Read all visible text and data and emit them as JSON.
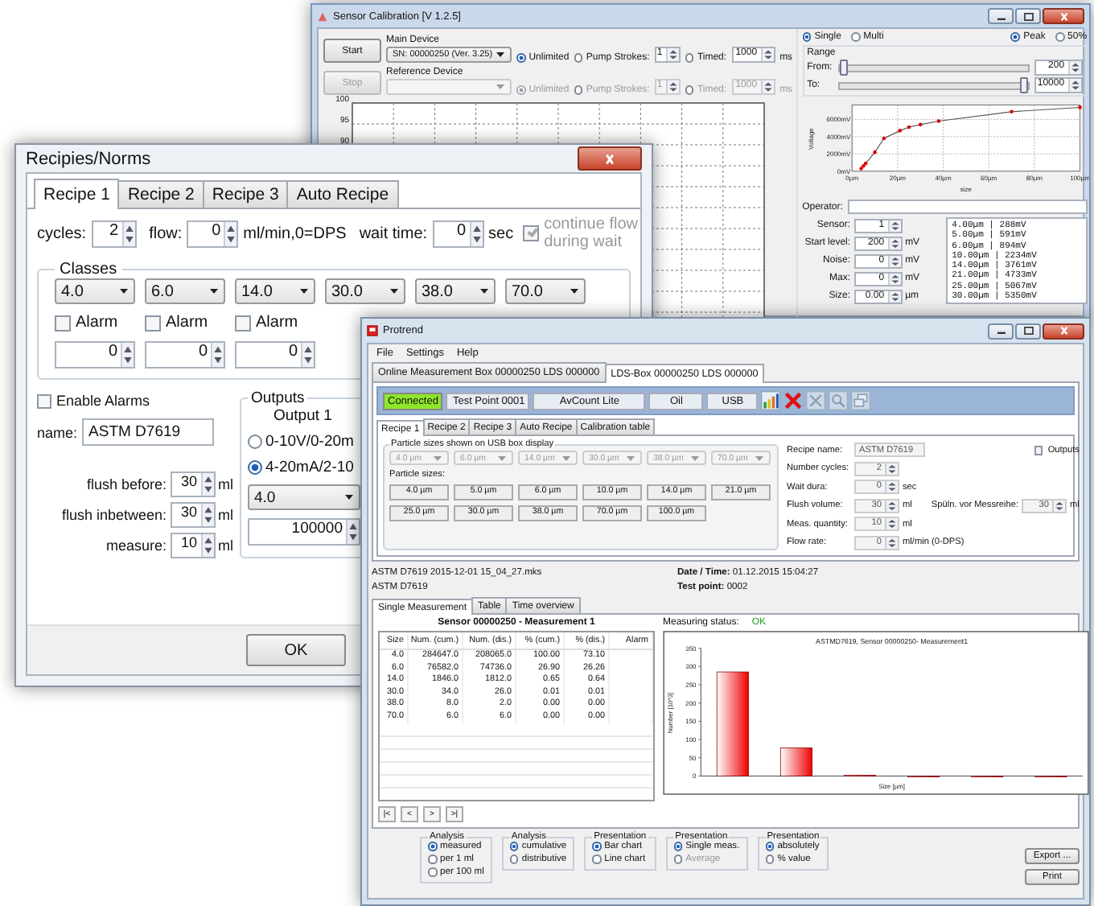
{
  "calibration_window": {
    "title": "Sensor Calibration [V 1.2.5]",
    "devices": [
      {
        "button": "Start",
        "label": "Main Device",
        "value": "SN: 00000250 (Ver. 3.25)",
        "disabled": false,
        "modes": [
          {
            "label": "Unlimited",
            "selected": true
          },
          {
            "label": "Pump Strokes:",
            "selected": false
          },
          {
            "label": "Timed:",
            "selected": false
          }
        ],
        "strokes": "1",
        "time": "1000",
        "unit": "ms"
      },
      {
        "button": "Stop",
        "label": "Reference Device",
        "disabled": true,
        "modes": [
          {
            "label": "Unlimited",
            "selected": true
          },
          {
            "label": "Pump Strokes:",
            "selected": false
          },
          {
            "label": "Timed:",
            "selected": false
          }
        ],
        "strokes": "1",
        "time": "1000",
        "unit": "ms"
      }
    ],
    "plot": {
      "yticks": [
        "100",
        "95",
        "90"
      ]
    },
    "mode_options": [
      {
        "label": "Single",
        "selected": true
      },
      {
        "label": "Multi",
        "selected": false
      }
    ],
    "peak_options": [
      {
        "label": "Peak",
        "selected": true
      },
      {
        "label": "50%",
        "selected": false
      }
    ],
    "range": {
      "title": "Range",
      "from": {
        "label": "From:",
        "level": 0.0,
        "value": "200"
      },
      "to": {
        "label": "To:",
        "level": 1.0,
        "value": "10000"
      }
    },
    "calibration_chart": {
      "chart_data": {
        "type": "line",
        "xlabel": "size",
        "ylabel": "Voltage",
        "x": [
          4,
          5,
          6,
          10,
          14,
          21,
          25,
          30,
          38,
          70,
          100
        ],
        "values": [
          300,
          600,
          900,
          2200,
          3800,
          4700,
          5100,
          5400,
          5800,
          6900,
          7400
        ],
        "xlim": [
          0,
          100
        ],
        "ylim": [
          0,
          7500
        ],
        "grid": true,
        "xticks": [
          {
            "value": 0,
            "label": "0µm"
          },
          {
            "value": 20,
            "label": "20µm"
          },
          {
            "value": 40,
            "label": "40µm"
          },
          {
            "value": 60,
            "label": "60µm"
          },
          {
            "value": 80,
            "label": "80µm"
          },
          {
            "value": 100,
            "label": "100µm"
          }
        ],
        "yticks": [
          {
            "value": 0,
            "label": "0mV"
          },
          {
            "value": 2000,
            "label": "2000mV"
          },
          {
            "value": 4000,
            "label": "4000mV"
          },
          {
            "value": 6000,
            "label": "6000mV"
          }
        ]
      }
    },
    "operator": {
      "label": "Operator:"
    },
    "fields": [
      {
        "label": "Sensor:",
        "value": "1"
      },
      {
        "label": "Start level:",
        "value": "200",
        "unit": "mV"
      },
      {
        "label": "Noise:",
        "value": "0",
        "unit": "mV"
      },
      {
        "label": "Max:",
        "value": "0",
        "unit": "mV"
      },
      {
        "label": "Size:",
        "value": "0.00",
        "unit": "µm"
      }
    ],
    "points": [
      "4.00µm | 288mV",
      "5.00µm | 591mV",
      "6.00µm | 894mV",
      "10.00µm | 2234mV",
      "14.00µm | 3761mV",
      "21.00µm | 4733mV",
      "25.00µm | 5067mV",
      "30.00µm | 5350mV"
    ]
  },
  "recipes_window": {
    "title": "Recipies/Norms",
    "tabs": [
      {
        "label": "Recipe 1",
        "selected": true
      },
      {
        "label": "Recipe 2",
        "selected": false
      },
      {
        "label": "Recipe 3",
        "selected": false
      },
      {
        "label": "Auto Recipe",
        "selected": false
      }
    ],
    "cycles": {
      "label": "cycles:",
      "value": "2"
    },
    "flow": {
      "label": "flow:",
      "value": "0",
      "unit": "ml/min,0=DPS"
    },
    "wait": {
      "label": "wait time:",
      "value": "0",
      "unit": "sec"
    },
    "continue_flow": {
      "label": "continue flow during wait",
      "checked": true,
      "disabled": true
    },
    "classes": {
      "title": "Classes",
      "sizes": [
        "4.0",
        "6.0",
        "14.0",
        "30.0",
        "38.0",
        "70.0"
      ],
      "alarms": [
        {
          "label": "Alarm",
          "checked": false,
          "value": "0"
        },
        {
          "label": "Alarm",
          "checked": false,
          "value": "0"
        },
        {
          "label": "Alarm",
          "checked": false,
          "value": "0"
        }
      ]
    },
    "enable_alarms": {
      "label": "Enable Alarms",
      "checked": false
    },
    "name": {
      "label": "name:",
      "value": "ASTM D7619"
    },
    "volumes": [
      {
        "label": "flush before:",
        "value": "30",
        "unit": "ml"
      },
      {
        "label": "flush inbetween:",
        "value": "30",
        "unit": "ml"
      },
      {
        "label": "measure:",
        "value": "10",
        "unit": "ml"
      }
    ],
    "outputs": {
      "title": "Outputs",
      "output": "Output 1",
      "options": [
        {
          "label": "0-10V/0-20m",
          "selected": false
        },
        {
          "label": "4-20mA/2-10",
          "selected": true
        }
      ],
      "size": "4.0",
      "value": "100000"
    },
    "buttons": [
      "OK"
    ]
  },
  "protrend_window": {
    "title": "Protrend",
    "menu": [
      "File",
      "Settings",
      "Help"
    ],
    "device_tabs": [
      {
        "label": "Online Measurement Box 00000250 LDS 000000",
        "selected": false
      },
      {
        "label": "LDS-Box 00000250 LDS 000000",
        "selected": true
      }
    ],
    "status": {
      "connection": "Connected",
      "connected": true,
      "fields": [
        "Test Point 0001",
        "AvCount Lite",
        "Oil",
        "USB"
      ]
    },
    "toolbar": [
      {
        "kind": "chart",
        "disabled": false
      },
      {
        "kind": "delete",
        "disabled": false
      },
      {
        "kind": "tools",
        "disabled": true
      },
      {
        "kind": "search",
        "disabled": true
      },
      {
        "kind": "windows",
        "disabled": true
      }
    ],
    "recipe_tabs": [
      {
        "label": "Recipe 1",
        "selected": true
      },
      {
        "label": "Recipe 2",
        "selected": false
      },
      {
        "label": "Recipe 3",
        "selected": false
      },
      {
        "label": "Auto Recipe",
        "selected": false
      },
      {
        "label": "Calibration table",
        "selected": false
      }
    ],
    "display_sizes": {
      "title": "Particle sizes shown on USB box display",
      "values": [
        "4.0 µm",
        "6.0 µm",
        "14.0 µm",
        "30.0 µm",
        "38.0 µm",
        "70.0 µm"
      ]
    },
    "particle_sizes": {
      "title": "Particle sizes:",
      "values": [
        "4.0 µm",
        "5.0 µm",
        "6.0 µm",
        "10.0 µm",
        "14.0 µm",
        "21.0 µm",
        "25.0 µm",
        "30.0 µm",
        "38.0 µm",
        "70.0 µm",
        "100.0 µm"
      ]
    },
    "recipe_fields": [
      {
        "kind": "text",
        "label": "Recipe name:",
        "value": "ASTM D7619"
      },
      {
        "kind": "spin",
        "label": "Number cycles:",
        "value": "2"
      },
      {
        "kind": "spin",
        "label": "Wait dura:",
        "value": "0",
        "unit": "sec"
      },
      {
        "kind": "spin",
        "label": "Flush volume:",
        "value": "30",
        "unit": "ml",
        "extra": {
          "label": "Spüln. vor Messreihe:",
          "value": "30",
          "unit": "ml"
        }
      },
      {
        "kind": "spin",
        "label": "Meas. quantity:",
        "value": "10",
        "unit": "ml"
      },
      {
        "kind": "spin",
        "label": "Flow rate:",
        "value": "0",
        "unit": "ml/min (0-DPS)"
      }
    ],
    "outputs_check": {
      "label": "Outputs",
      "checked": false
    },
    "file": "ASTM D7619 2015-12-01 15_04_27.mks",
    "recipe": "ASTM D7619",
    "date": {
      "label": "Date / Time:",
      "value": "01.12.2015 15:04:27"
    },
    "test_point": {
      "label": "Test point:",
      "value": "0002"
    },
    "view_tabs": [
      {
        "label": "Single Measurement",
        "selected": true
      },
      {
        "label": "Table",
        "selected": false
      },
      {
        "label": "Time overview",
        "selected": false
      }
    ],
    "table": {
      "title": "Sensor 00000250 - Measurement 1",
      "columns": [
        "Size",
        "Num. (cum.)",
        "Num. (dis.)",
        "% (cum.)",
        "% (dis.)",
        "Alarm"
      ],
      "rows": [
        [
          "4.0",
          "284647.0",
          "208065.0",
          "100.00",
          "73.10"
        ],
        [
          "6.0",
          "76582.0",
          "74736.0",
          "26.90",
          "26.26"
        ],
        [
          "14.0",
          "1846.0",
          "1812.0",
          "0.65",
          "0.64"
        ],
        [
          "30.0",
          "34.0",
          "26.0",
          "0.01",
          "0.01"
        ],
        [
          "38.0",
          "8.0",
          "2.0",
          "0.00",
          "0.00"
        ],
        [
          "70.0",
          "6.0",
          "6.0",
          "0.00",
          "0.00"
        ]
      ]
    },
    "measuring_status": {
      "label": "Measuring status:",
      "value": "OK"
    },
    "chart": {
      "chart_data": {
        "type": "bar",
        "title": "ASTMD7619, Sensor 00000250- Measurement1",
        "xlabel": "Size [µm]",
        "ylabel": "Number [10^3]",
        "values": [
          285,
          77,
          2,
          0,
          0,
          0
        ],
        "ylim": [
          0,
          350
        ],
        "yticks": [
          0,
          50,
          100,
          150,
          200,
          250,
          300,
          350
        ]
      }
    },
    "nav": [
      "|<",
      "<",
      ">",
      ">|"
    ],
    "options": [
      {
        "title": "Analysis",
        "items": [
          {
            "label": "measured",
            "selected": true,
            "disabled": false
          },
          {
            "label": "per 1 ml",
            "selected": false,
            "disabled": false
          },
          {
            "label": "per 100 ml",
            "selected": false,
            "disabled": false
          }
        ]
      },
      {
        "title": "Analysis",
        "items": [
          {
            "label": "cumulative",
            "selected": true,
            "disabled": false
          },
          {
            "label": "distributive",
            "selected": false,
            "disabled": false
          }
        ]
      },
      {
        "title": "Presentation",
        "items": [
          {
            "label": "Bar chart",
            "selected": true,
            "disabled": false
          },
          {
            "label": "Line chart",
            "selected": false,
            "disabled": false
          }
        ]
      },
      {
        "title": "Presentation",
        "items": [
          {
            "label": "Single meas.",
            "selected": true,
            "disabled": false
          },
          {
            "label": "Average",
            "selected": false,
            "disabled": true
          }
        ]
      },
      {
        "title": "Presentation",
        "items": [
          {
            "label": "absolutely",
            "selected": true,
            "disabled": false
          },
          {
            "label": "% value",
            "selected": false,
            "disabled": false
          }
        ]
      }
    ],
    "buttons": [
      "Export ...",
      "Print"
    ]
  }
}
